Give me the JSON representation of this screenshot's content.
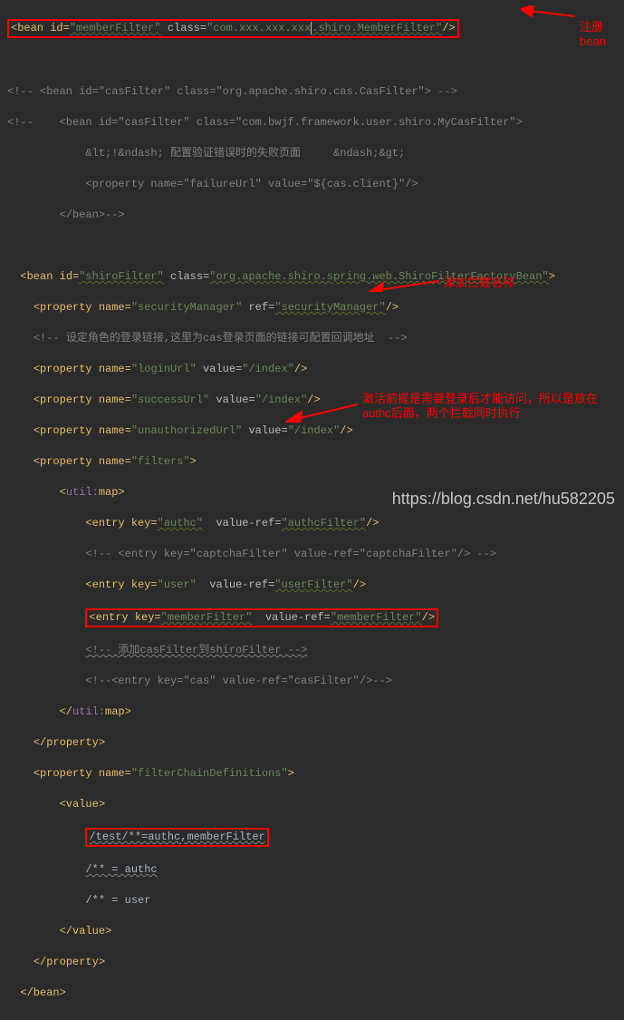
{
  "line1": {
    "open": "<bean id=",
    "id": "\"memberFilter\"",
    "class_attr": " class=",
    "class_val": "\"com.xxx.xxx.xxx",
    "class_val2": ".shiro.MemberFilter\"",
    "close": "/>"
  },
  "anno1": "注册\nbean",
  "line2": "<!-- <bean id=\"casFilter\" class=\"org.apache.shiro.cas.CasFilter\"> -->",
  "line3_a": "<!--    <bean id=\"casFilter\" class=\"com.bwjf.framework.user.shiro.MyCasFilter\">",
  "line3_b": "            &lt;!&ndash; 配置验证错误时的失败页面     &ndash;&gt;",
  "line3_c": "            <property name=\"failureUrl\" value=\"${cas.client}\"/>",
  "line3_d": "        </bean>-->",
  "shiro_open": {
    "a": "<bean id=",
    "id": "\"shiroFilter\"",
    "cls": " class=",
    "clsval": "\"org.apache.shiro.spring.web.ShiroFilterFactoryBean\"",
    "end": ">"
  },
  "prop_sec": {
    "a": "<property name=",
    "v1": "\"securityManager\"",
    "b": " ref=",
    "v2": "\"securityManager\"",
    "c": "/>"
  },
  "comment_login": "<!-- 设定角色的登录链接,这里为cas登录页面的链接可配置回调地址  -->",
  "prop_login": {
    "a": "<property name=",
    "v1": "\"loginUrl\"",
    "b": " value=",
    "v2": "\"/index\"",
    "c": "/>"
  },
  "prop_success": {
    "a": "<property name=",
    "v1": "\"successUrl\"",
    "b": " value=",
    "v2": "\"/index\"",
    "c": "/>"
  },
  "prop_unauth": {
    "a": "<property name=",
    "v1": "\"unauthorizedUrl\"",
    "b": " value=",
    "v2": "\"/index\"",
    "c": "/>"
  },
  "prop_filters": {
    "a": "<property name=",
    "v1": "\"filters\"",
    "c": ">"
  },
  "util_map_open": "<util:map>",
  "util_map_close": "</util:map>",
  "entry_authc": {
    "a": "<entry key=",
    "v1": "\"authc\"",
    "b": "  value-ref=",
    "v2": "\"authcFilter\"",
    "c": "/>"
  },
  "entry_captcha": "<!-- <entry key=\"captchaFilter\" value-ref=\"captchaFilter\"/> -->",
  "entry_user": {
    "a": "<entry key=",
    "v1": "\"user\"",
    "b": "  value-ref=",
    "v2": "\"userFilter\"",
    "c": "/>"
  },
  "anno2": "添加拦截名称",
  "entry_member": {
    "a": "<entry key=",
    "v1": "\"memberFilter\"",
    "b": "  value-ref=",
    "v2": "\"memberFilter\"",
    "c": "/>"
  },
  "comment_casfilter": "<!-- 添加casFilter到shiroFilter -->",
  "entry_cas": "<!--<entry key=\"cas\" value-ref=\"casFilter\"/>-->",
  "prop_close": "</property>",
  "prop_fcd": {
    "a": "<property name=",
    "v1": "\"filterChainDefinitions\"",
    "c": ">"
  },
  "value_open": "<value>",
  "value_close": "</value>",
  "fcd_test": "/test/**=authc,memberFilter",
  "fcd_authc": "/** = authc",
  "fcd_user": "/** = user",
  "anno3": "激活前提是需要登录后才能访问，所以是放在authc后面，两个拦截同时执行",
  "bean_close": "</bean>",
  "watermark": "https://blog.csdn.net/hu582205"
}
